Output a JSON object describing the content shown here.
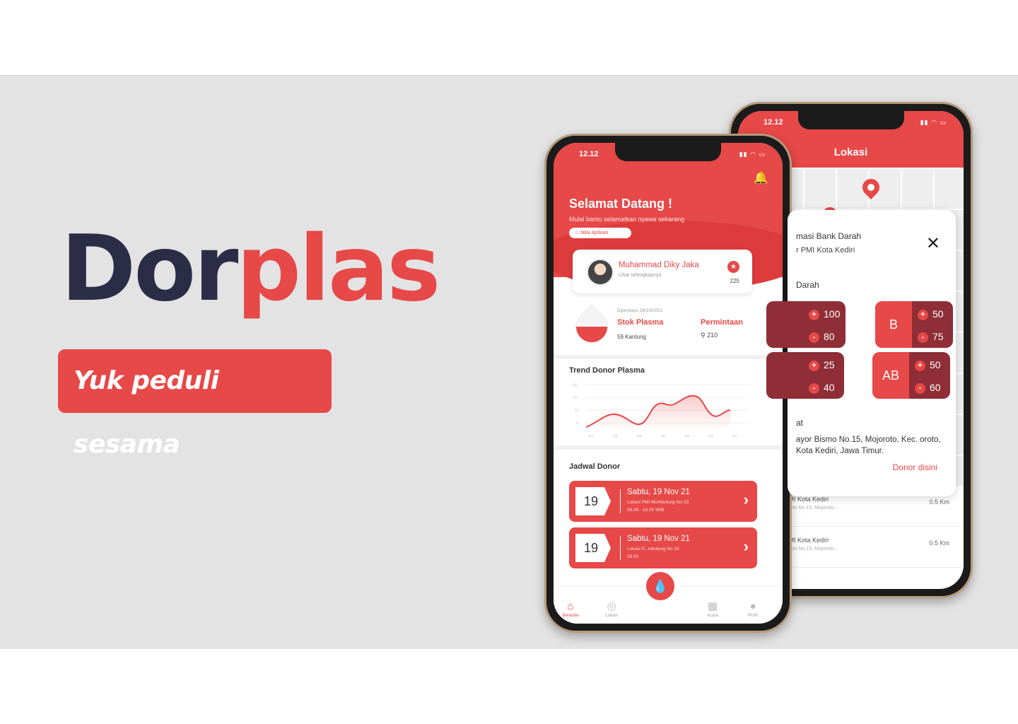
{
  "brand": {
    "part1": "Dor",
    "part2": "plas"
  },
  "tagline": "Yuk peduli sesama",
  "colors": {
    "accent": "#e74848",
    "dark": "#2b2d47",
    "banner_bg": "#e3e3e4"
  },
  "back_phone": {
    "status": {
      "time": "12.12",
      "icons": "signal-wifi-battery"
    },
    "title": "Lokasi",
    "popup": {
      "title": "masi Bank Darah",
      "subtitle": "r PMI Kota Kediri",
      "close_icon": "close-icon",
      "section_blood": "Darah",
      "cards": [
        {
          "label": "",
          "plus": "100",
          "minus": "80"
        },
        {
          "label": "B",
          "plus": "50",
          "minus": "75"
        },
        {
          "label": "",
          "plus": "25",
          "minus": "40"
        },
        {
          "label": "AB",
          "plus": "50",
          "minus": "60"
        }
      ],
      "section_address": "at",
      "address": "ayor Bismo No.15, Mojoroto, Kec. oroto, Kota Kediri, Jawa Timur.",
      "donor_link": "Donor disini"
    },
    "list": [
      {
        "name": "r PMI Kota Kediri",
        "address": "r Bismo No.15, Mojoroto...",
        "distance": "0.5 Km"
      },
      {
        "name": "r PMI Kota Kediri",
        "address": "r Bismo No.15, Mojoroto...",
        "distance": "0.5 Km"
      }
    ]
  },
  "front_phone": {
    "status": {
      "time": "12.12",
      "icons": "signal-wifi-battery"
    },
    "bell_icon": "bell-icon",
    "welcome": "Selamat Datang !",
    "welcome_sub": "Mulai bantu selamatkan nyawa sekarang",
    "rate_button": "☆  Nilai Aplikasi",
    "profile": {
      "name": "Muhammad Diky Jaka",
      "sub": "Lihat selengkapnya",
      "points": "225"
    },
    "stock": {
      "updated": "Diperbarui 28/10/2021",
      "title": "Stok Plasma",
      "value": "59 Kantung",
      "request_title": "Permintaan",
      "request_value": "⚲ 210"
    },
    "trend_title": "Trend Donor Plasma",
    "schedule_title": "Jadwal Donor",
    "schedule": [
      {
        "day": "19",
        "date": "Sabtu, 19 Nov 21",
        "location": "Lokasi PMI Mumbulung No 23",
        "time": "09.00 - 10.00 WIB"
      },
      {
        "day": "19",
        "date": "Sabtu, 19 Nov 21",
        "location": "Lokasi P...mbulung No 23",
        "time": "09.00"
      }
    ],
    "tabs": [
      {
        "label": "Beranda",
        "icon": "home-icon"
      },
      {
        "label": "Lokasi",
        "icon": "compass-icon"
      },
      {
        "label": "Acara",
        "icon": "grid-icon"
      },
      {
        "label": "Profil",
        "icon": "user-icon"
      }
    ],
    "fab_icon": "blood-drop-icon"
  }
}
